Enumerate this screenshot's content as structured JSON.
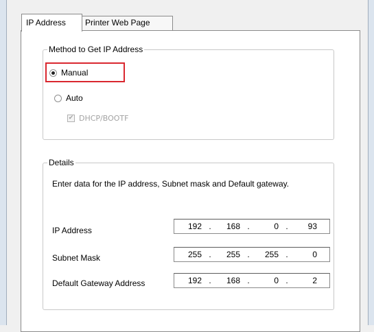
{
  "tabs": [
    {
      "label": "IP Address",
      "active": true
    },
    {
      "label": "Printer Web Page",
      "active": false
    }
  ],
  "method_group": {
    "legend": "Method to Get IP Address",
    "options": [
      {
        "label": "Manual",
        "checked": true,
        "highlighted": true
      },
      {
        "label": "Auto",
        "checked": false
      }
    ],
    "dhcp": {
      "label": "DHCP/BOOTF",
      "checked": true,
      "disabled": true
    }
  },
  "details_group": {
    "legend": "Details",
    "description": "Enter data for the IP address, Subnet mask and Default gateway.",
    "fields": {
      "ip_address": {
        "label": "IP Address",
        "octets": [
          "192",
          "168",
          "0",
          "93"
        ]
      },
      "subnet_mask": {
        "label": "Subnet Mask",
        "octets": [
          "255",
          "255",
          "255",
          "0"
        ]
      },
      "gateway": {
        "label": "Default Gateway Address",
        "octets": [
          "192",
          "168",
          "0",
          "2"
        ]
      }
    }
  },
  "colors": {
    "highlight": "#d9262e",
    "window_frame": "#dbe4ee"
  },
  "icons": {
    "checked_glyph": "✔"
  }
}
